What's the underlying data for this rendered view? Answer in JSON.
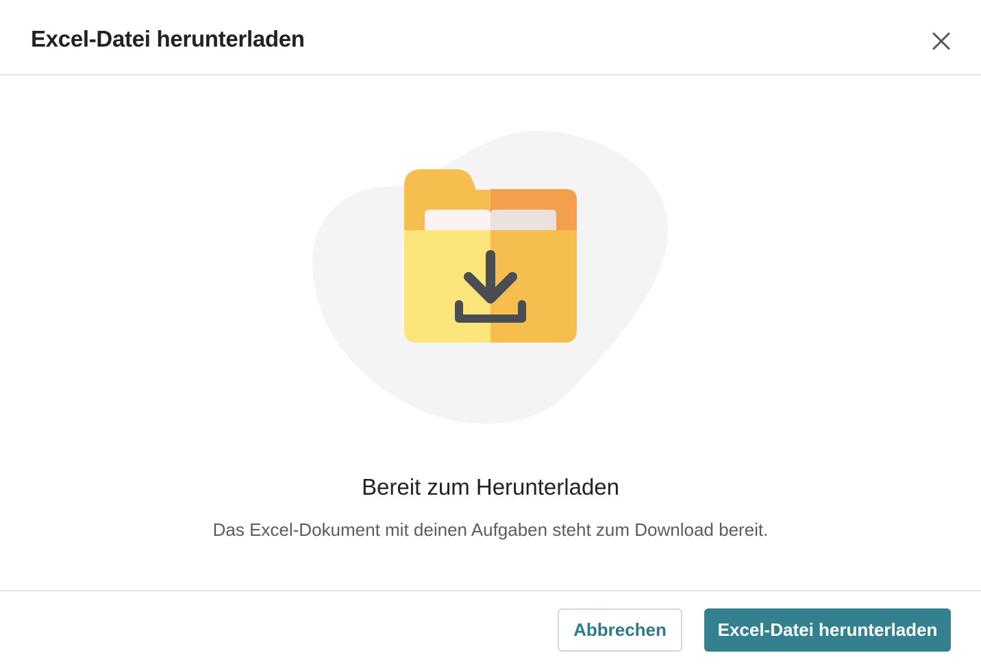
{
  "dialog": {
    "title": "Excel-Datei herunterladen",
    "close_icon": "close-icon"
  },
  "content": {
    "illustration_icon": "folder-download-icon",
    "heading": "Bereit zum Herunterladen",
    "description": "Das Excel-Dokument mit deinen Aufgaben steht zum Download bereit."
  },
  "footer": {
    "cancel_label": "Abbrechen",
    "download_label": "Excel-Datei herunterladen"
  },
  "colors": {
    "accent": "#33808e",
    "folder_light": "#fce57b",
    "folder_mid": "#f5be4e",
    "folder_dark": "#f2a04b",
    "arrow": "#4a4d54",
    "blob": "#f4f4f4"
  }
}
